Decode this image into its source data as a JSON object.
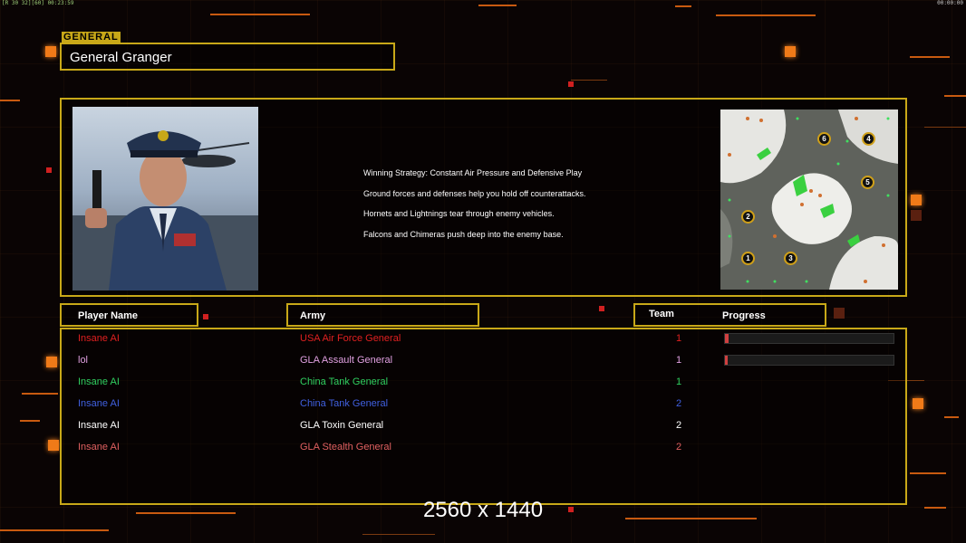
{
  "hud": {
    "top_left": "[R 30 32][60] 00:23:59",
    "top_right": "00:00:00"
  },
  "general": {
    "tag": "GENERAL",
    "name": "General Granger"
  },
  "strategy": {
    "lines": [
      "Winning Strategy: Constant Air Pressure and Defensive Play",
      "Ground forces and defenses help you hold off counterattacks.",
      "Hornets and Lightnings tear through enemy vehicles.",
      "Falcons and Chimeras push deep into the enemy base."
    ]
  },
  "minimap": {
    "markers": [
      {
        "label": "6"
      },
      {
        "label": "4"
      },
      {
        "label": "5"
      },
      {
        "label": "2"
      },
      {
        "label": "1"
      },
      {
        "label": "3"
      }
    ]
  },
  "headers": {
    "player_name": "Player Name",
    "army": "Army",
    "team": "Team",
    "progress": "Progress"
  },
  "players": [
    {
      "name": "Insane AI",
      "army": "USA Air Force General",
      "team": "1",
      "color": "#e02020",
      "progress": 0.02
    },
    {
      "name": "lol",
      "army": "GLA Assault General",
      "team": "1",
      "color": "#e0a0e0",
      "progress": 0.01
    },
    {
      "name": "Insane AI",
      "army": "China Tank General",
      "team": "1",
      "color": "#30d060"
    },
    {
      "name": "Insane AI",
      "army": "China Tank General",
      "team": "2",
      "color": "#4060e0"
    },
    {
      "name": "Insane AI",
      "army": "GLA Toxin General",
      "team": "2",
      "color": "#ffffff"
    },
    {
      "name": "Insane AI",
      "army": "GLA Stealth General",
      "team": "2",
      "color": "#e06060"
    }
  ],
  "resolution_label": "2560 x 1440",
  "colors": {
    "accent": "#c8a818",
    "orange": "#f07a18"
  }
}
